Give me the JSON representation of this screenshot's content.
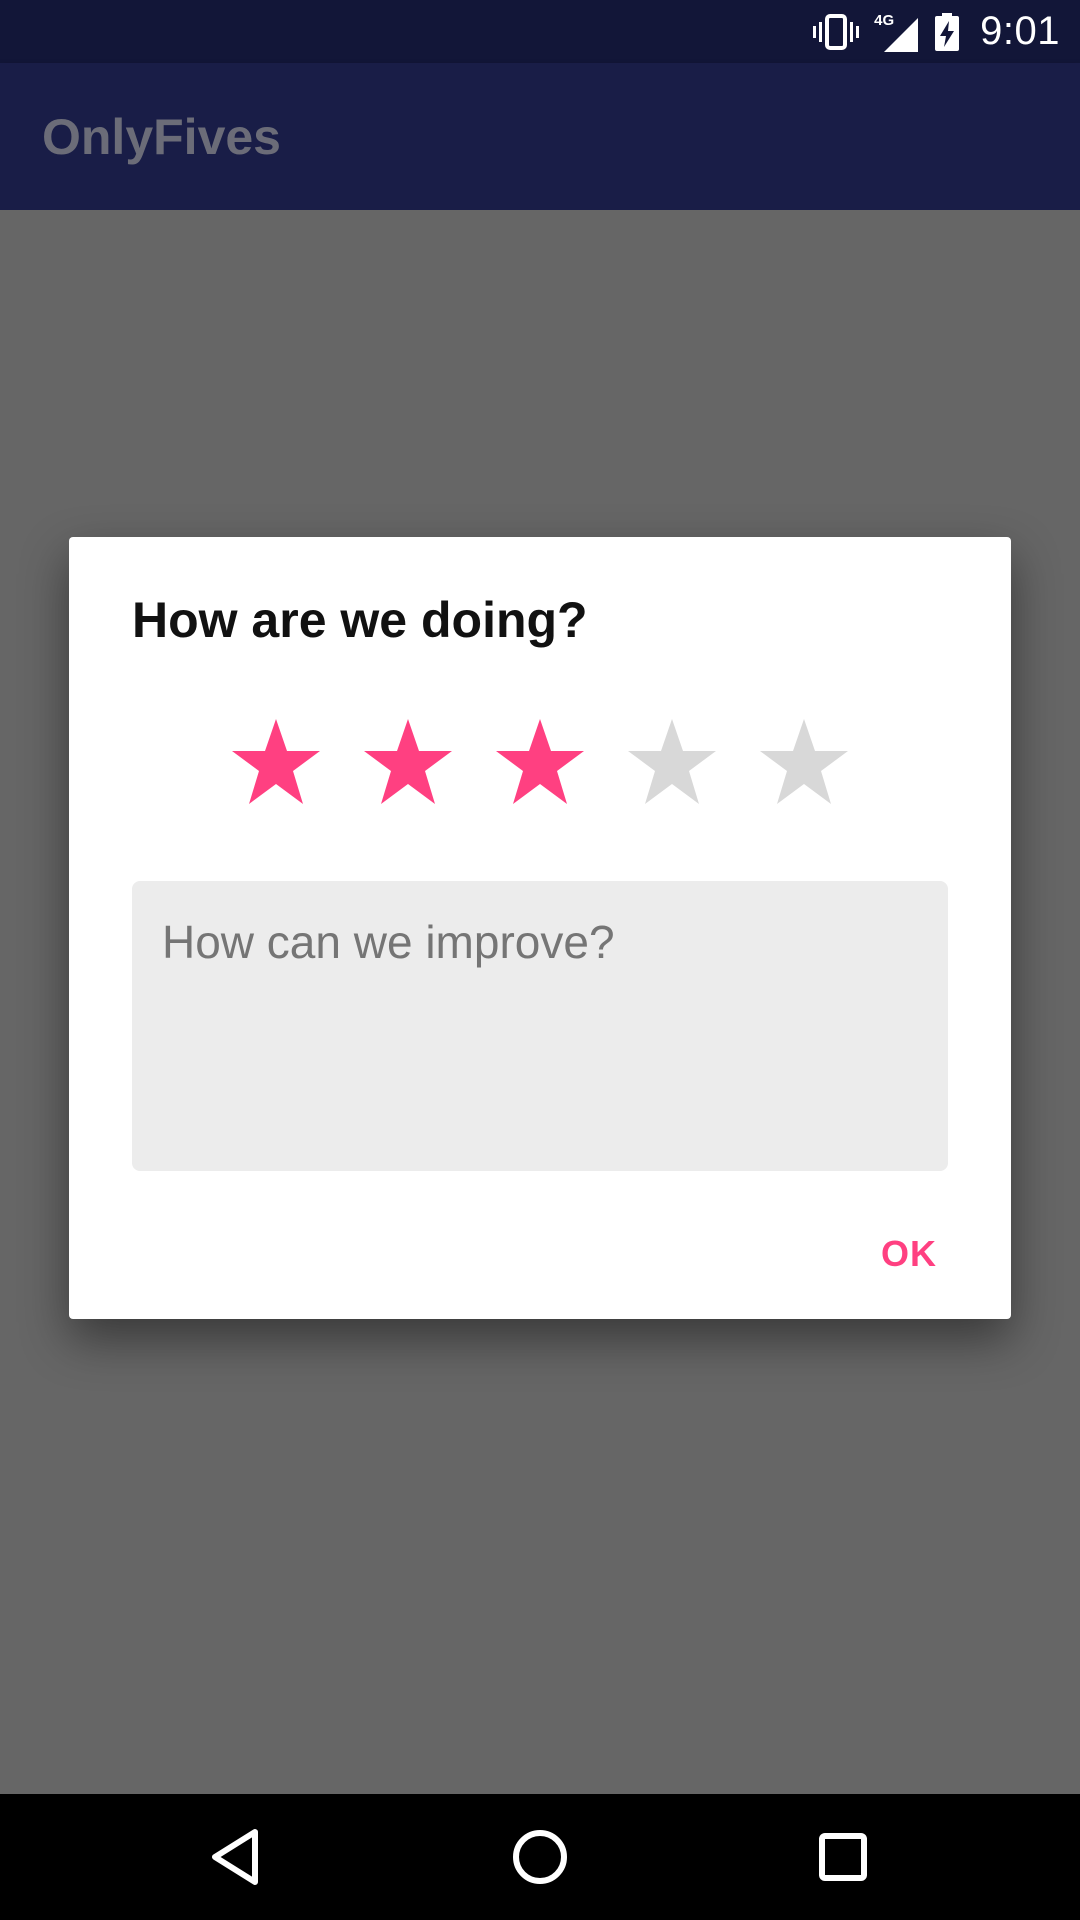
{
  "status_bar": {
    "time": "9:01",
    "network_label": "4G",
    "icons": [
      "vibrate-icon",
      "signal-icon",
      "battery-charging-icon"
    ]
  },
  "app_bar": {
    "title": "OnlyFives"
  },
  "dialog": {
    "title": "How are we doing?",
    "rating": {
      "value": 3,
      "max": 5
    },
    "feedback": {
      "placeholder": "How can we improve?",
      "value": ""
    },
    "ok_label": "OK"
  },
  "colors": {
    "accent": "#ff4081",
    "star_inactive": "#d8d8d8",
    "status_bar": "#121638",
    "app_bar": "#191d47",
    "scrim_background": "#666666"
  },
  "nav_bar": {
    "icons": [
      "back-icon",
      "home-icon",
      "recents-icon"
    ]
  }
}
